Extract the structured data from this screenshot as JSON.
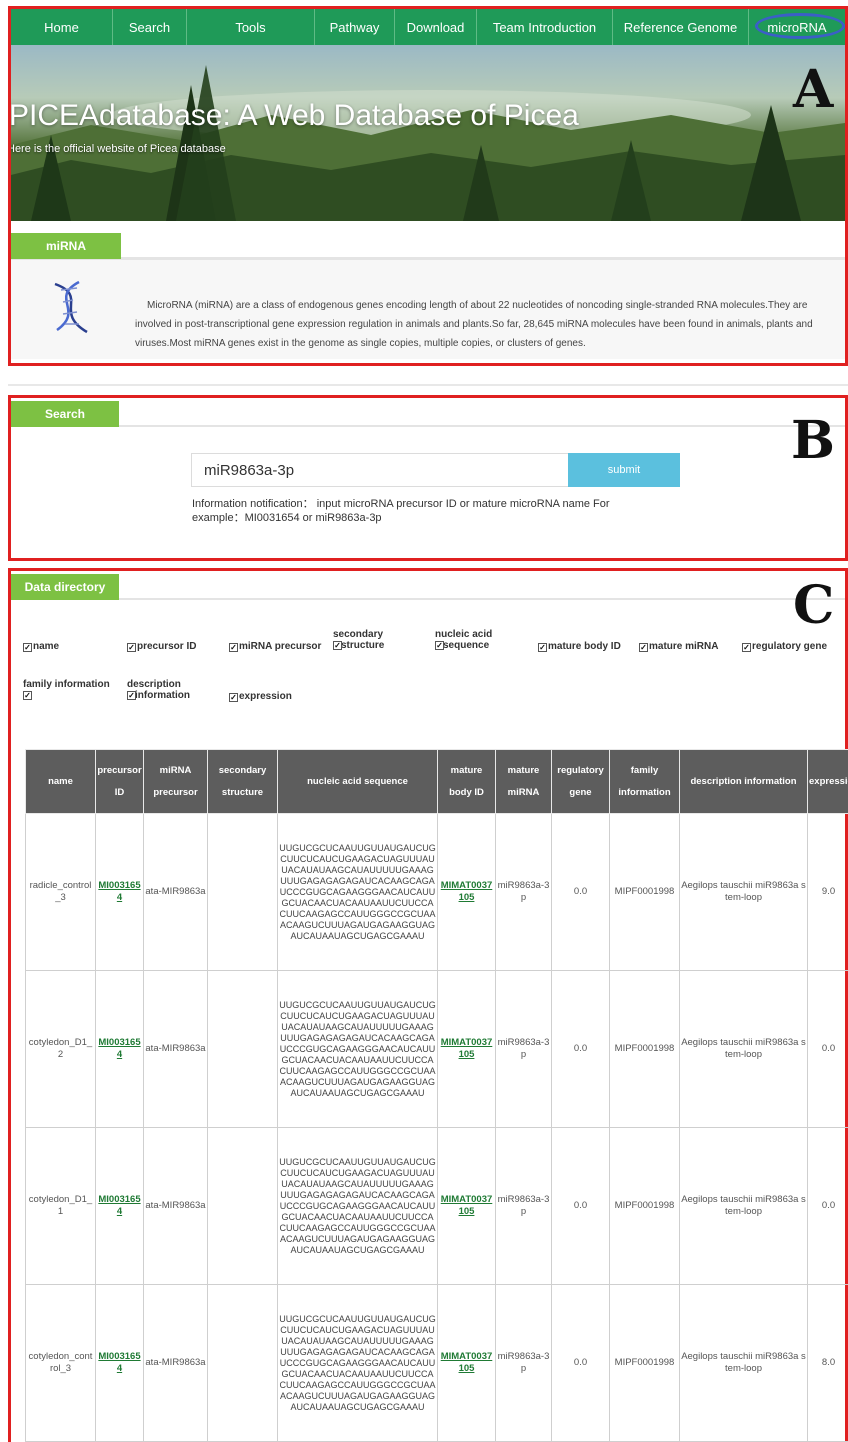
{
  "nav": [
    "Home",
    "Search",
    "Tools",
    "Pathway",
    "Download",
    "Team Introduction",
    "Reference Genome",
    "microRNA"
  ],
  "banner": {
    "title": "PICEAdatabase: A Web Database of Picea",
    "subtitle": "Here is the official website of Picea database"
  },
  "panel_letters": {
    "a": "A",
    "b": "B",
    "c": "C"
  },
  "mirna": {
    "tab": "miRNA",
    "icon": "dna-helix-icon",
    "description": "MicroRNA (miRNA) are a class of endogenous genes encoding length of about 22 nucleotides of noncoding single-stranded RNA molecules.They are involved in post-transcriptional gene expression regulation in animals and plants.So far, 28,645 miRNA molecules have been found in animals, plants and viruses.Most miRNA genes exist in the genome as single copies, multiple copies, or clusters of genes."
  },
  "search": {
    "tab": "Search",
    "input_value": "miR9863a-3p",
    "submit": "submit",
    "notification": "Information notification： input microRNA precursor ID or mature microRNA name For example：MI0031654 or miR9863a-3p"
  },
  "data_directory": {
    "tab": "Data directory",
    "checkboxes": [
      "name",
      "precursor ID",
      "miRNA precursor",
      "secondary structure",
      "nucleic acid sequence",
      "mature body ID",
      "mature miRNA",
      "regulatory gene",
      "family information",
      "description information",
      "expression"
    ],
    "columns": [
      "name",
      "precursor ID",
      "miRNA precursor",
      "secondary structure",
      "nucleic acid sequence",
      "mature body ID",
      "mature miRNA",
      "regulatory gene",
      "family information",
      "description information",
      "expression"
    ],
    "rows": [
      {
        "name": "radicle_control_3",
        "precursor_id": "MI0031654",
        "precursor": "ata-MIR9863a",
        "structure": "",
        "sequence": "UUGUCGCUCAAUUGUUAUGAUCUGCUUCUCAUCUGAAGACUAGUUUAUUACAUAUAAGCAUAUUUUUGAAAGUUUGAGAGAGAGAUCACAAGCAGAUCCCGUGCAGAAGGGAACAUCAUUGCUACAACUACAAUAAUUCUUCCACUUCAAGAGCCAUUGGGCCGCUAAACAAGUCUUUAGAUGAGAAGGUAGAUCAUAAUAGCUGAGCGAAAU",
        "mature_id": "MIMAT0037105",
        "mature": "miR9863a-3p",
        "regulatory": "0.0",
        "family": "MIPF0001998",
        "description": "Aegilops tauschii miR9863a stem-loop",
        "expression": "9.0"
      },
      {
        "name": "cotyledon_D1_2",
        "precursor_id": "MI0031654",
        "precursor": "ata-MIR9863a",
        "structure": "",
        "sequence": "UUGUCGCUCAAUUGUUAUGAUCUGCUUCUCAUCUGAAGACUAGUUUAUUACAUAUAAGCAUAUUUUUGAAAGUUUGAGAGAGAGAUCACAAGCAGAUCCCGUGCAGAAGGGAACAUCAUUGCUACAACUACAAUAAUUCUUCCACUUCAAGAGCCAUUGGGCCGCUAAACAAGUCUUUAGAUGAGAAGGUAGAUCAUAAUAGCUGAGCGAAAU",
        "mature_id": "MIMAT0037105",
        "mature": "miR9863a-3p",
        "regulatory": "0.0",
        "family": "MIPF0001998",
        "description": "Aegilops tauschii miR9863a stem-loop",
        "expression": "0.0"
      },
      {
        "name": "cotyledon_D1_1",
        "precursor_id": "MI0031654",
        "precursor": "ata-MIR9863a",
        "structure": "",
        "sequence": "UUGUCGCUCAAUUGUUAUGAUCUGCUUCUCAUCUGAAGACUAGUUUAUUACAUAUAAGCAUAUUUUUGAAAGUUUGAGAGAGAGAUCACAAGCAGAUCCCGUGCAGAAGGGAACAUCAUUGCUACAACUACAAUAAUUCUUCCACUUCAAGAGCCAUUGGGCCGCUAAACAAGUCUUUAGAUGAGAAGGUAGAUCAUAAUAGCUGAGCGAAAU",
        "mature_id": "MIMAT0037105",
        "mature": "miR9863a-3p",
        "regulatory": "0.0",
        "family": "MIPF0001998",
        "description": "Aegilops tauschii miR9863a stem-loop",
        "expression": "0.0"
      },
      {
        "name": "cotyledon_control_3",
        "precursor_id": "MI0031654",
        "precursor": "ata-MIR9863a",
        "structure": "",
        "sequence": "UUGUCGCUCAAUUGUUAUGAUCUGCUUCUCAUCUGAAGACUAGUUUAUUACAUAUAAGCAUAUUUUUGAAAGUUUGAGAGAGAGAUCACAAGCAGAUCCCGUGCAGAAGGGAACAUCAUUGCUACAACUACAAUAAUUCUUCCACUUCAAGAGCCAUUGGGCCGCUAAACAAGUCUUUAGAUGAGAAGGUAGAUCAUAAUAGCUGAGCGAAAU",
        "mature_id": "MIMAT0037105",
        "mature": "miR9863a-3p",
        "regulatory": "0.0",
        "family": "MIPF0001998",
        "description": "Aegilops tauschii miR9863a stem-loop",
        "expression": "8.0"
      }
    ]
  },
  "colors": {
    "nav": "#1f9a58",
    "tab": "#7dc143",
    "panel_border": "#e02020",
    "submit": "#5bc0de",
    "table_header": "#5d5d5d",
    "link": "#1f7a34",
    "highlight_oval": "#3b5fc7"
  }
}
